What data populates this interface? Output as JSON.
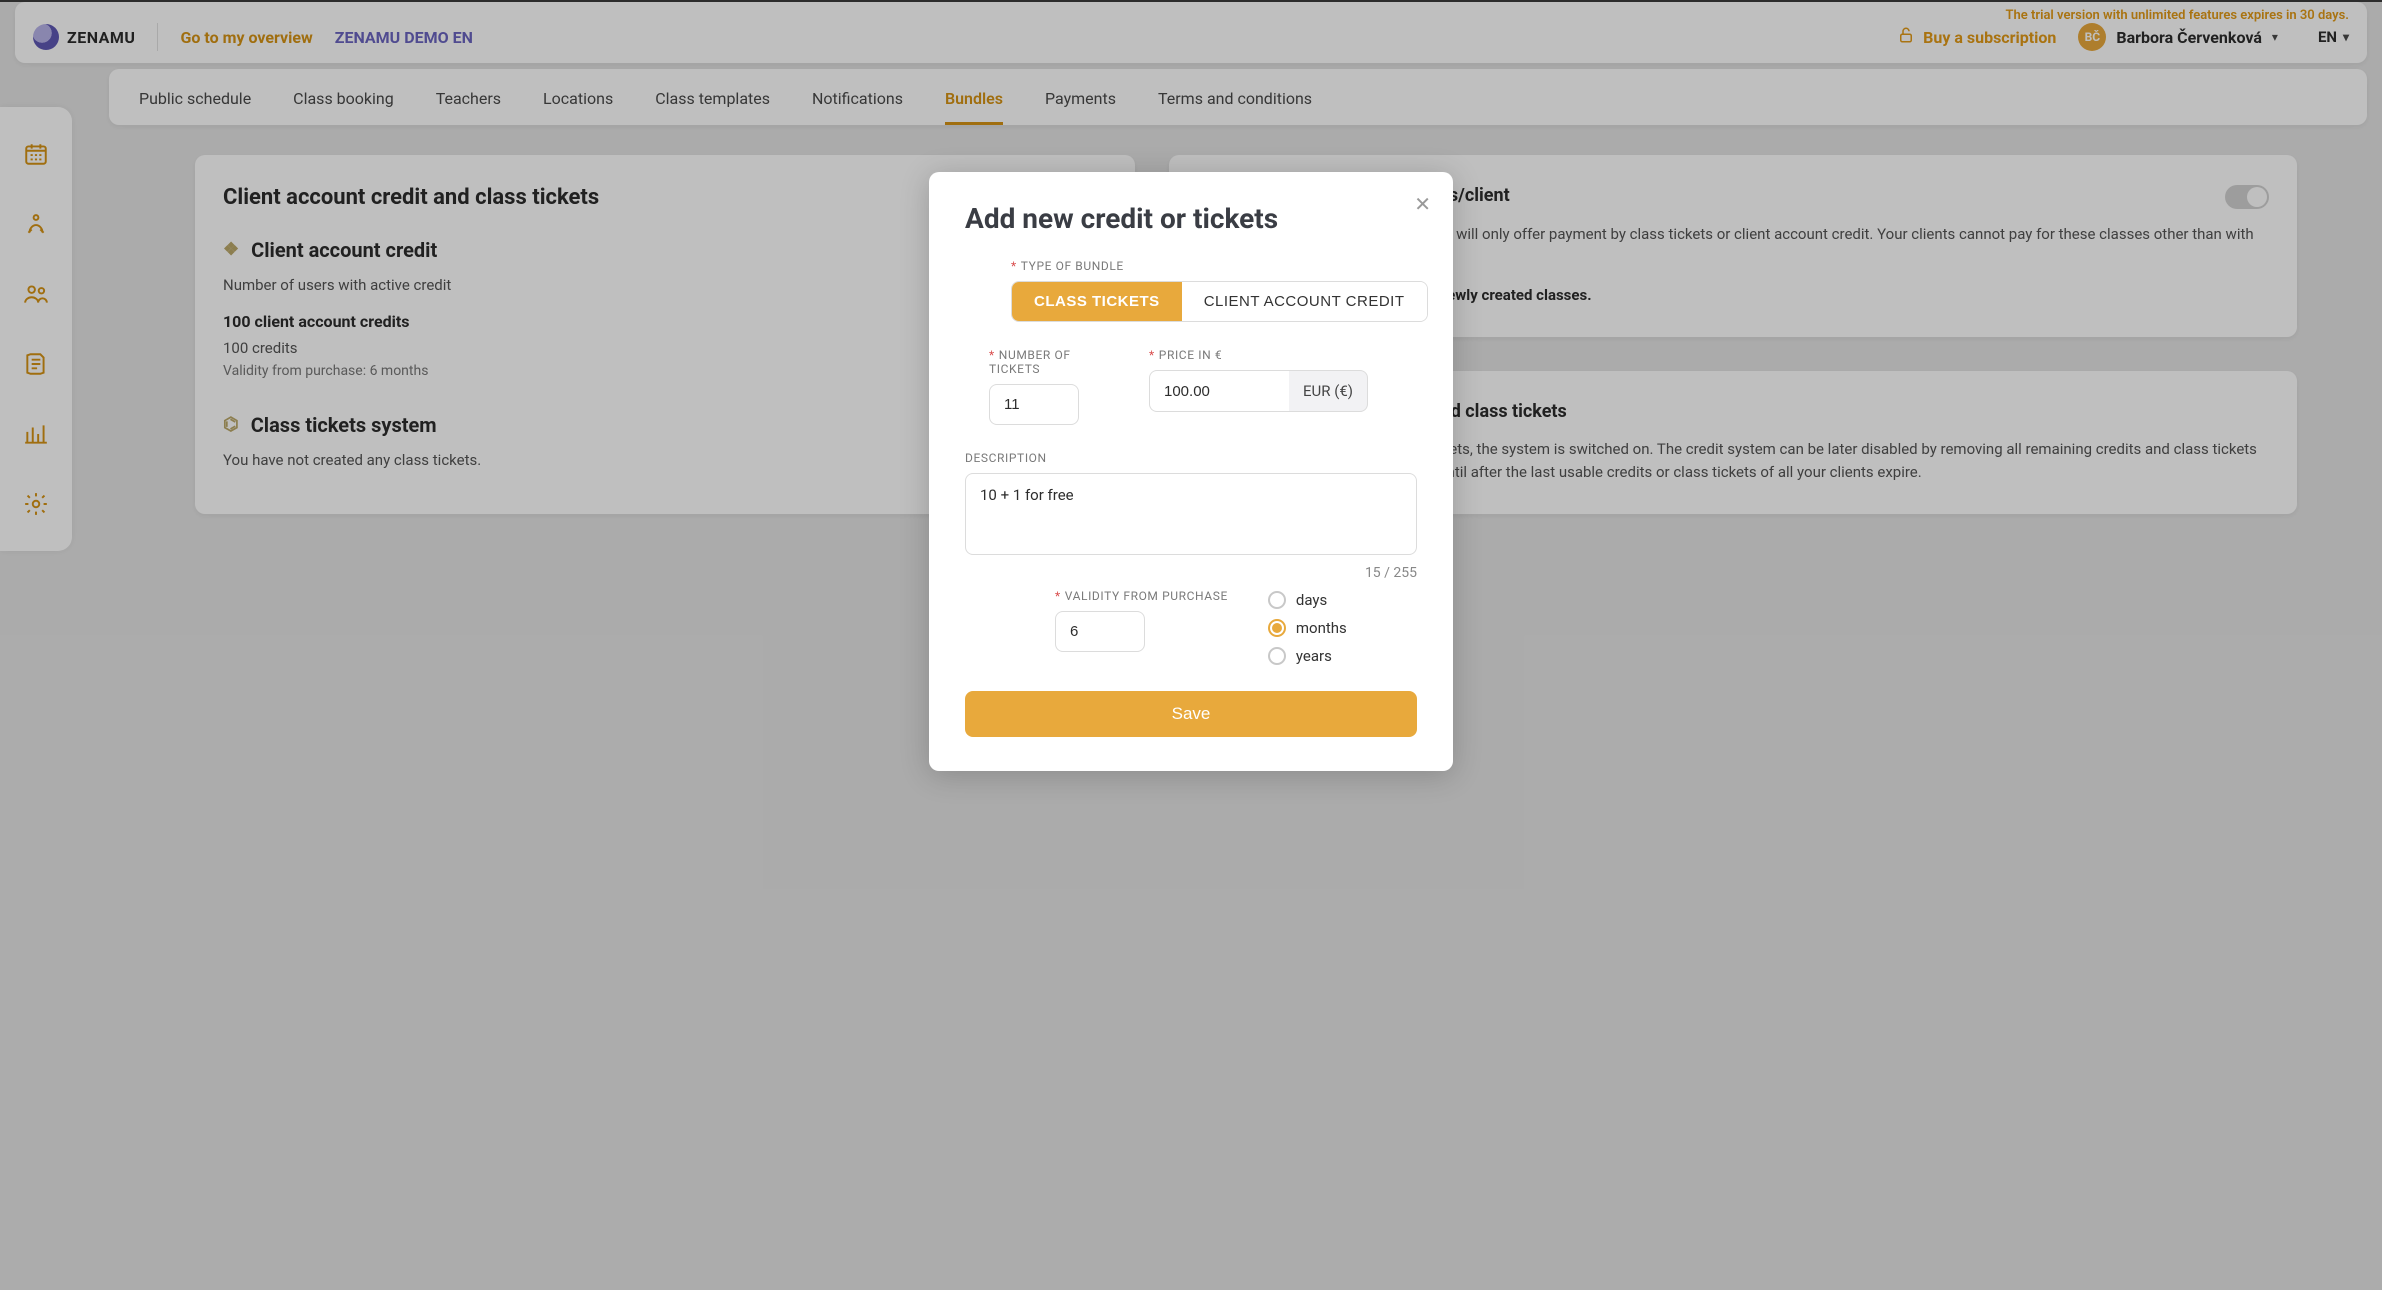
{
  "header": {
    "trial_notice": "The trial version with unlimited features expires in 30 days.",
    "brand": "ZENAMU",
    "overview_link": "Go to my overview",
    "studio_name": "ZENAMU DEMO EN",
    "buy_subscription": "Buy a subscription",
    "user_initials": "BČ",
    "user_name": "Barbora Červenková",
    "language": "EN"
  },
  "tabs": [
    "Public schedule",
    "Class booking",
    "Teachers",
    "Locations",
    "Class templates",
    "Notifications",
    "Bundles",
    "Payments",
    "Terms and conditions"
  ],
  "active_tab_index": 6,
  "left_card": {
    "heading": "Client account credit and class tickets",
    "sub1": "Client account credit",
    "active_users_line": "Number of users with active credit",
    "bold_line": "100 client account credits",
    "credits_line": "100 credits",
    "validity_line": "Validity from purchase: 6 months",
    "sub2": "Class tickets system",
    "none_line": "You have not created any class tickets."
  },
  "right_card1": {
    "toggle_label": "Payment in form of class tickets/client",
    "p1": "After activation, newly created classes will only offer payment by class tickets or client account credit. Your clients cannot pay for these classes other than with credits.",
    "p2": "This setting will only take effect for newly created classes."
  },
  "right_card2": {
    "heading2": "Disable client account credit and class tickets",
    "p3": "If clients have valid credit or class tickets, the system is switched on. The credit system can be later disabled by removing all remaining credits and class tickets offers => the system remains active until after the last usable credits or class tickets of all your clients expire."
  },
  "modal": {
    "title": "Add new credit or tickets",
    "type_label": "TYPE OF BUNDLE",
    "seg_option1": "CLASS TICKETS",
    "seg_option2": "CLIENT ACCOUNT CREDIT",
    "num_tickets_label": "NUMBER OF TICKETS",
    "num_tickets_value": "11",
    "price_label": "PRICE IN €",
    "price_value": "100.00",
    "currency_addon": "EUR (€)",
    "desc_label": "DESCRIPTION",
    "desc_value": "10 + 1 for free",
    "counter": "15 / 255",
    "validity_label": "VALIDITY FROM PURCHASE",
    "validity_value": "6",
    "radios": [
      "days",
      "months",
      "years"
    ],
    "radio_selected_index": 1,
    "save_label": "Save"
  }
}
